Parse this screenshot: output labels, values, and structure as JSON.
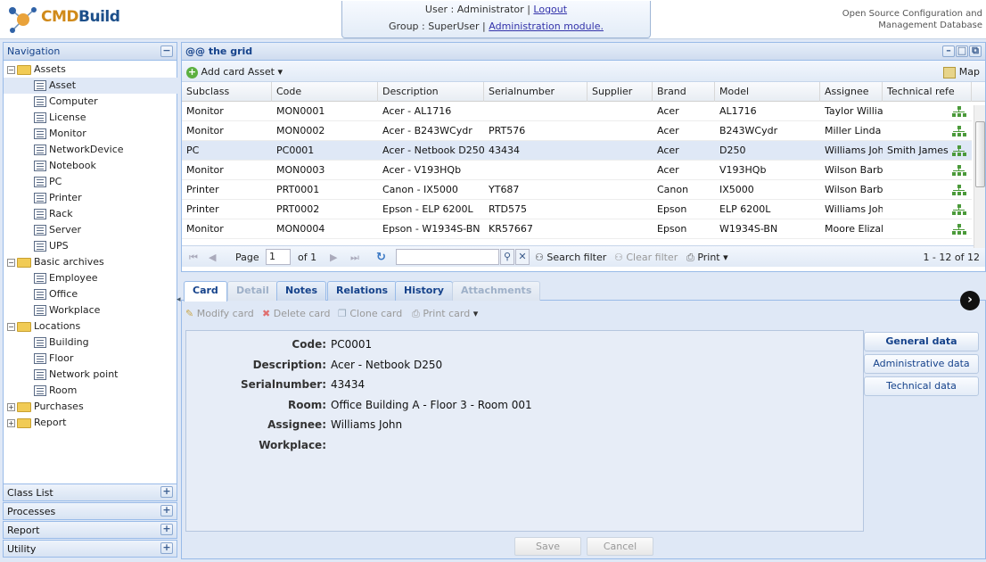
{
  "header": {
    "logo_text_a": "CMD",
    "logo_text_b": "Build",
    "user_label": "User : Administrator",
    "separator": "|",
    "logout": "Logout",
    "group_label": "Group : SuperUser",
    "admin_link": "Administration module.",
    "tagline_1": "Open Source Configuration and",
    "tagline_2": "Management Database"
  },
  "nav": {
    "title": "Navigation",
    "collapse": "−",
    "tree": [
      {
        "label": "Assets",
        "type": "folder",
        "expanded": true
      },
      {
        "label": "Asset",
        "type": "leaf",
        "selected": true
      },
      {
        "label": "Computer",
        "type": "leaf"
      },
      {
        "label": "License",
        "type": "leaf"
      },
      {
        "label": "Monitor",
        "type": "leaf"
      },
      {
        "label": "NetworkDevice",
        "type": "leaf"
      },
      {
        "label": "Notebook",
        "type": "leaf"
      },
      {
        "label": "PC",
        "type": "leaf"
      },
      {
        "label": "Printer",
        "type": "leaf"
      },
      {
        "label": "Rack",
        "type": "leaf"
      },
      {
        "label": "Server",
        "type": "leaf"
      },
      {
        "label": "UPS",
        "type": "leaf"
      },
      {
        "label": "Basic archives",
        "type": "folder",
        "expanded": true
      },
      {
        "label": "Employee",
        "type": "leaf"
      },
      {
        "label": "Office",
        "type": "leaf"
      },
      {
        "label": "Workplace",
        "type": "leaf"
      },
      {
        "label": "Locations",
        "type": "folder",
        "expanded": true
      },
      {
        "label": "Building",
        "type": "leaf"
      },
      {
        "label": "Floor",
        "type": "leaf"
      },
      {
        "label": "Network point",
        "type": "leaf"
      },
      {
        "label": "Room",
        "type": "leaf"
      },
      {
        "label": "Purchases",
        "type": "folder",
        "expanded": false
      },
      {
        "label": "Report",
        "type": "folder",
        "expanded": false
      }
    ],
    "accordions": [
      "Class List",
      "Processes",
      "Report",
      "Utility"
    ],
    "plus": "+"
  },
  "grid": {
    "title": "@@ the grid",
    "add_card": "Add card Asset",
    "map": "Map",
    "columns": [
      "Subclass",
      "Code",
      "Description",
      "Serialnumber",
      "Supplier",
      "Brand",
      "Model",
      "Assignee",
      "Technical refe"
    ],
    "rows": [
      [
        "Monitor",
        "MON0001",
        "Acer - AL1716",
        "",
        "",
        "Acer",
        "AL1716",
        "Taylor William",
        ""
      ],
      [
        "Monitor",
        "MON0002",
        "Acer - B243WCydr",
        "PRT576",
        "",
        "Acer",
        "B243WCydr",
        "Miller Linda",
        ""
      ],
      [
        "PC",
        "PC0001",
        "Acer - Netbook D250",
        "43434",
        "",
        "Acer",
        "D250",
        "Williams John",
        "Smith James"
      ],
      [
        "Monitor",
        "MON0003",
        "Acer - V193HQb",
        "",
        "",
        "Acer",
        "V193HQb",
        "Wilson Barbar",
        ""
      ],
      [
        "Printer",
        "PRT0001",
        "Canon - IX5000",
        "YT687",
        "",
        "Canon",
        "IX5000",
        "Wilson Barbar",
        ""
      ],
      [
        "Printer",
        "PRT0002",
        "Epson - ELP 6200L",
        "RTD575",
        "",
        "Epson",
        "ELP 6200L",
        "Williams John",
        ""
      ],
      [
        "Monitor",
        "MON0004",
        "Epson - W1934S-BN",
        "KR57667",
        "",
        "Epson",
        "W1934S-BN",
        "Moore Elizabe",
        ""
      ]
    ],
    "selected_row": 2,
    "paging": {
      "page_label": "Page",
      "page_value": "1",
      "of_label": "of 1",
      "search_filter": "Search filter",
      "clear_filter": "Clear filter",
      "print": "Print",
      "range": "1 - 12 of 12"
    }
  },
  "detail": {
    "tabs": [
      {
        "label": "Card",
        "state": "active"
      },
      {
        "label": "Detail",
        "state": "disabled"
      },
      {
        "label": "Notes",
        "state": "normal"
      },
      {
        "label": "Relations",
        "state": "normal"
      },
      {
        "label": "History",
        "state": "normal"
      },
      {
        "label": "Attachments",
        "state": "disabled"
      }
    ],
    "toolbar": [
      "Modify card",
      "Delete card",
      "Clone card",
      "Print card"
    ],
    "fields": [
      {
        "label": "Code:",
        "value": "PC0001"
      },
      {
        "label": "Description:",
        "value": "Acer - Netbook D250"
      },
      {
        "label": "Serialnumber:",
        "value": "43434"
      },
      {
        "label": "Room:",
        "value": "Office Building A - Floor 3 - Room 001"
      },
      {
        "label": "Assignee:",
        "value": "Williams John"
      },
      {
        "label": "Workplace:",
        "value": ""
      }
    ],
    "side_buttons": [
      {
        "label": "General data",
        "active": true
      },
      {
        "label": "Administrative data",
        "active": false
      },
      {
        "label": "Technical data",
        "active": false
      }
    ],
    "save": "Save",
    "cancel": "Cancel"
  },
  "colors": {
    "accent": "#15428b",
    "panel_border": "#99bbe8",
    "selection": "#dfe8f6"
  }
}
